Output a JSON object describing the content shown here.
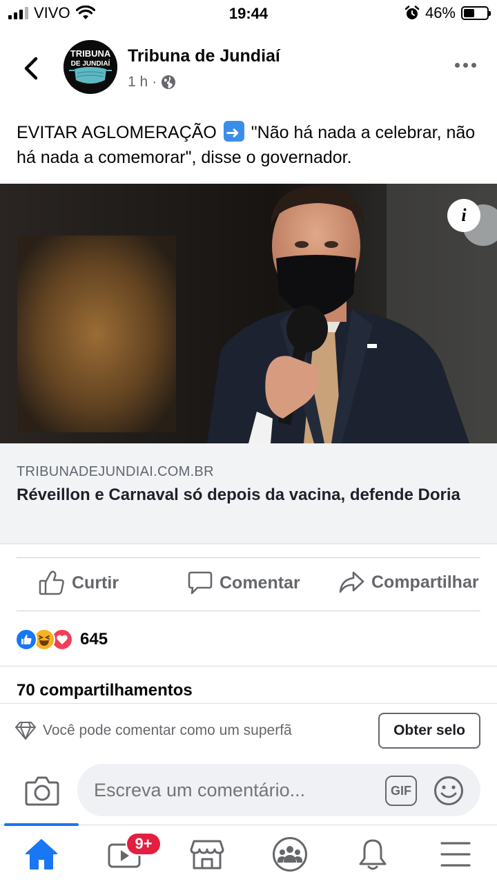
{
  "status_bar": {
    "carrier": "VIVO",
    "time": "19:44",
    "battery_percent": "46%",
    "battery_level": 0.46,
    "signal_bars": 3
  },
  "header": {
    "page_name": "Tribuna de Jundiaí",
    "time_ago": "1 h",
    "separator": "·",
    "privacy_icon": "globe-icon",
    "avatar_line1": "TRIBUNA",
    "avatar_line2": "DE JUNDIAÍ"
  },
  "post": {
    "text_part1": "EVITAR AGLOMERAÇÃO",
    "text_part2": " \"Não há nada a celebrar, não há nada a comemorar\", disse o governador.",
    "info_label": "i"
  },
  "link_preview": {
    "domain": "TRIBUNADEJUNDIAI.COM.BR",
    "title": "Réveillon e Carnaval só depois da vacina, defende Doria"
  },
  "actions": {
    "like": "Curtir",
    "comment": "Comentar",
    "share": "Compartilhar"
  },
  "reactions": {
    "count": "645",
    "types": [
      "like",
      "haha",
      "love"
    ],
    "colors": {
      "like": "#1877f2",
      "haha": "#f7b125",
      "love": "#f33e58"
    }
  },
  "shares": "70 compartilhamentos",
  "superfan": {
    "text": "Você pode comentar como um superfã",
    "button": "Obter selo"
  },
  "composer": {
    "placeholder": "Escreva um comentário...",
    "gif_label": "GIF"
  },
  "bottom_nav": {
    "items": [
      "home",
      "watch",
      "marketplace",
      "groups",
      "notifications",
      "menu"
    ],
    "watch_badge": "9+",
    "active": "home",
    "accent": "#1877f2"
  }
}
